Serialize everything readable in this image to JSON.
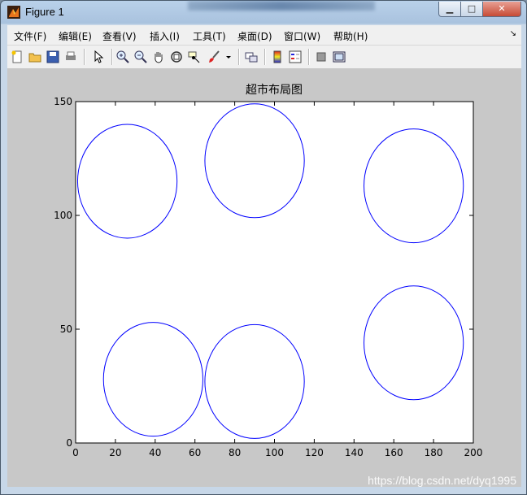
{
  "window": {
    "title": "Figure 1"
  },
  "menu": [
    "文件(F)",
    "编辑(E)",
    "查看(V)",
    "插入(I)",
    "工具(T)",
    "桌面(D)",
    "窗口(W)",
    "帮助(H)"
  ],
  "toolbar": [
    "new-figure",
    "open-file",
    "save",
    "print",
    "select-arrow",
    "zoom-in",
    "zoom-out",
    "pan",
    "rotate-3d",
    "data-cursor",
    "brush",
    "link",
    "colorbar",
    "legend",
    "hide-plot-tools",
    "show-plot-tools"
  ],
  "chart_data": {
    "type": "scatter",
    "title": "超市布局图",
    "xlabel": "",
    "ylabel": "",
    "xlim": [
      0,
      200
    ],
    "ylim": [
      0,
      150
    ],
    "xticks": [
      0,
      20,
      40,
      60,
      80,
      100,
      120,
      140,
      160,
      180,
      200
    ],
    "yticks": [
      0,
      50,
      100,
      150
    ],
    "grid": false,
    "line_color": "#0000ff",
    "circles": [
      {
        "cx": 26,
        "cy": 115,
        "r": 25
      },
      {
        "cx": 90,
        "cy": 124,
        "r": 25
      },
      {
        "cx": 170,
        "cy": 113,
        "r": 25
      },
      {
        "cx": 39,
        "cy": 28,
        "r": 25
      },
      {
        "cx": 90,
        "cy": 27,
        "r": 25
      },
      {
        "cx": 170,
        "cy": 44,
        "r": 25
      }
    ]
  },
  "watermark": "https://blog.csdn.net/dyq1995"
}
